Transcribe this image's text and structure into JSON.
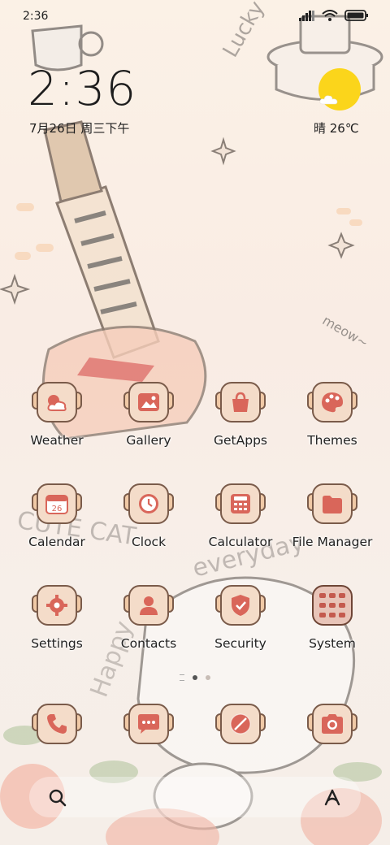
{
  "status_bar": {
    "time": "2:36",
    "signal_icon": "signal-icon",
    "wifi_icon": "wifi-icon",
    "battery_icon": "battery-icon"
  },
  "clock_widget": {
    "time": "2:36",
    "date": "7月26日 周三下午"
  },
  "weather_widget": {
    "text": "晴 26℃",
    "icon": "sun-cloud-icon",
    "sun_color": "#fbd51b"
  },
  "apps": [
    {
      "label": "Weather",
      "icon": "weather-icon"
    },
    {
      "label": "Gallery",
      "icon": "gallery-icon"
    },
    {
      "label": "GetApps",
      "icon": "getapps-icon"
    },
    {
      "label": "Themes",
      "icon": "themes-icon"
    },
    {
      "label": "Calendar",
      "icon": "calendar-icon"
    },
    {
      "label": "Clock",
      "icon": "clock-icon"
    },
    {
      "label": "Calculator",
      "icon": "calculator-icon"
    },
    {
      "label": "File Manager",
      "icon": "file-manager-icon"
    },
    {
      "label": "Settings",
      "icon": "settings-icon"
    },
    {
      "label": "Contacts",
      "icon": "contacts-icon"
    },
    {
      "label": "Security",
      "icon": "security-icon"
    },
    {
      "label": "System",
      "icon": "system-folder-icon"
    }
  ],
  "dock": [
    {
      "icon": "phone-icon"
    },
    {
      "icon": "messages-icon"
    },
    {
      "icon": "browser-icon"
    },
    {
      "icon": "camera-icon"
    }
  ],
  "page_indicator": {
    "pages": 2,
    "active": 1
  },
  "search": {
    "search_icon": "search-icon",
    "assistant_icon": "assistant-icon"
  },
  "colors": {
    "icon_red": "#d9665a",
    "icon_outline": "#7a5b4a",
    "icon_bg": "#f4dcc9"
  }
}
